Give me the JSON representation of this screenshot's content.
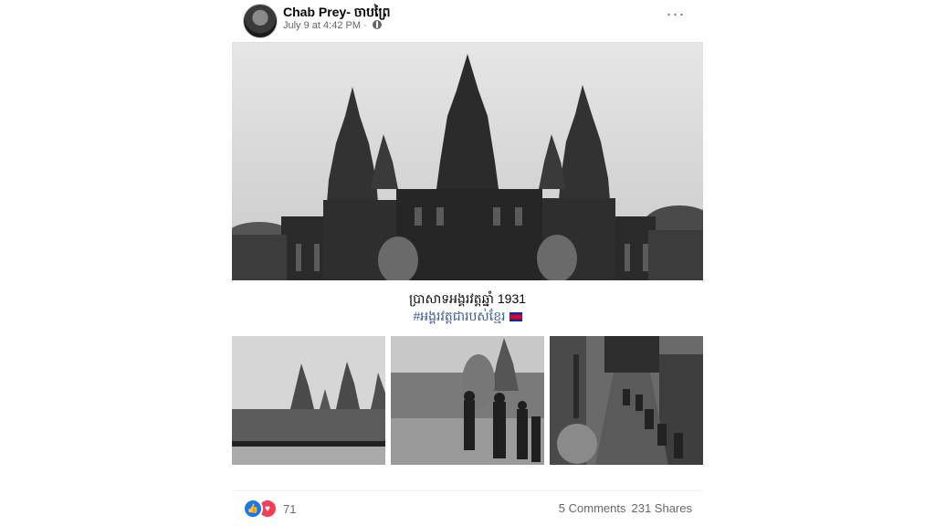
{
  "post": {
    "author": "Chab Prey- ចាបព្រៃ",
    "timestamp": "July 9 at 4:42 PM",
    "audience_icon": "globe-icon",
    "more_icon": "more-horizontal-icon",
    "caption_line1": "ប្រាសាទអង្គរវត្តឆ្នាំ 1931",
    "caption_hashtag": "#អង្គរវត្តជារបស់ខ្មែរ",
    "flag": "cambodia-flag"
  },
  "reactions": {
    "icons": [
      "like-icon",
      "love-icon"
    ],
    "count": "71"
  },
  "stats": {
    "comments": "5 Comments",
    "shares": "231 Shares"
  },
  "colors": {
    "link": "#385898",
    "meta": "#65676b",
    "like": "#1877f2",
    "love": "#f33e58"
  }
}
